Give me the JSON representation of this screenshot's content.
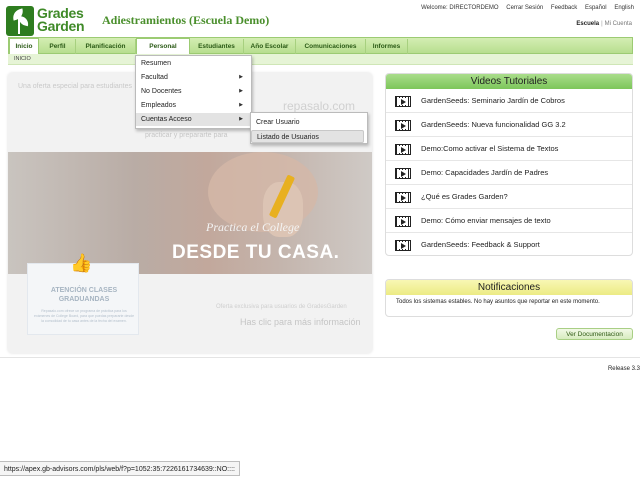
{
  "logo": {
    "line1": "Grades",
    "line2": "Garden"
  },
  "app_title": "Adiestramientos (Escuela Demo)",
  "top_links": {
    "welcome": "Welcome: DIRECTORDEMO",
    "logout": "Cerrar Sesión",
    "feedback": "Feedback",
    "spanish": "Español",
    "english": "English"
  },
  "context_links": {
    "school": "Escuela",
    "separator": "|",
    "account": "Mi Cuenta"
  },
  "nav": {
    "items": [
      "Inicio",
      "Perfil",
      "Planificación",
      "Personal",
      "Estudiantes",
      "Año Escolar",
      "Comunicaciones",
      "Informes"
    ],
    "active": "Inicio",
    "open": "Personal"
  },
  "breadcrumb": "INICIO",
  "dropdown": {
    "items": [
      {
        "label": "Resumen"
      },
      {
        "label": "Facultad"
      },
      {
        "label": "No Docentes"
      },
      {
        "label": "Empleados"
      },
      {
        "label": "Cuentas Acceso"
      }
    ],
    "arrow": "▶",
    "submenu": [
      {
        "label": "Crear Usuario"
      },
      {
        "label": "Listado de Usuarios"
      }
    ]
  },
  "banner": {
    "offer": "Una oferta especial para estudiantes",
    "brand": "repasalo.com",
    "practice": "practicar y prepararte para",
    "subtitle": "Practica el College",
    "headline": "DESDE TU CASA.",
    "card_title": "ATENCIÓN CLASES GRADUANDAS",
    "card_text": "Repasalo.com ofrece un programa de práctica para los exámenes de College Board, para que puedas prepararte desde la comodidad de tu casa antes de la fecha del examen.",
    "exclusive": "Oferta exclusiva para usuarios de GradesGarden",
    "click": "Has clic para más información"
  },
  "videos": {
    "title": "Videos Tutoriales",
    "items": [
      "GardenSeeds: Seminario Jardín de Cobros",
      "GardenSeeds: Nueva funcionalidad GG 3.2",
      "Demo:Como activar el Sistema de Textos",
      "Demo: Capacidades Jardín de Padres",
      "¿Qué es Grades Garden?",
      "Demo: Cómo enviar mensajes de texto",
      "GardenSeeds: Feedback & Support"
    ]
  },
  "notifications": {
    "title": "Notificaciones",
    "text": "Todos los sistemas estables. No hay asuntos que reportar en este momento."
  },
  "doc_button": "Ver Documentacion",
  "release": "Release 3.3",
  "status_url": "https://apex.gb-advisors.com/pls/web/f?p=1052:35:7226161734639::NO::::"
}
